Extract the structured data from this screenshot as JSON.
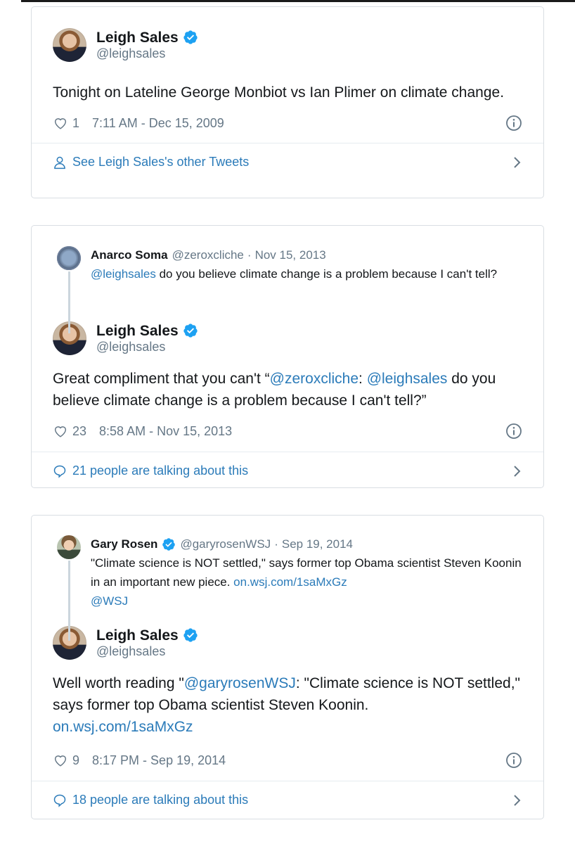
{
  "tweets": [
    {
      "author": {
        "name": "Leigh Sales",
        "handle": "@leighsales",
        "verified": true
      },
      "text": "Tonight on Lateline George Monbiot vs Ian Plimer on climate change.",
      "likes": "1",
      "timestamp": "7:11 AM - Dec 15, 2009",
      "footer": {
        "icon": "person-icon",
        "label": "See Leigh Sales's other Tweets"
      }
    },
    {
      "quoted": {
        "name": "Anarco Soma",
        "handle": "@zeroxcliche",
        "separator": "·",
        "date": "Nov 15, 2013",
        "mention": "@leighsales",
        "text": " do you believe climate change is a problem because I can't tell?"
      },
      "author": {
        "name": "Leigh Sales",
        "handle": "@leighsales",
        "verified": true
      },
      "text_parts": {
        "pre": "Great compliment that you can't “",
        "mention1": "@zeroxcliche",
        "mid": ": ",
        "mention2": "@leighsales",
        "post": " do you believe climate change is a problem because I can't tell?”"
      },
      "likes": "23",
      "timestamp": "8:58 AM - Nov 15, 2013",
      "footer": {
        "icon": "speech-bubble-icon",
        "label": "21 people are talking about this"
      }
    },
    {
      "quoted": {
        "name": "Gary Rosen",
        "verified": true,
        "handle": "@garyrosenWSJ",
        "separator": "·",
        "date": "Sep 19, 2014",
        "text": "\"Climate science is NOT settled,\" says former top Obama scientist Steven Koonin in an important new piece. ",
        "link": "on.wsj.com/1saMxGz",
        "link2": "@WSJ"
      },
      "author": {
        "name": "Leigh Sales",
        "handle": "@leighsales",
        "verified": true
      },
      "text_parts": {
        "pre": "Well worth reading \"",
        "mention1": "@garyrosenWSJ",
        "post": ": \"Climate science is NOT settled,\" says former top Obama scientist Steven Koonin.",
        "link": "on.wsj.com/1saMxGz"
      },
      "likes": "9",
      "timestamp": "8:17 PM - Sep 19, 2014",
      "footer": {
        "icon": "speech-bubble-icon",
        "label": "18 people are talking about this"
      }
    }
  ],
  "colors": {
    "link": "#2b7bb9",
    "verified": "#1da1f2",
    "muted": "#657786",
    "text": "#14171a",
    "border": "#d9dee3"
  }
}
